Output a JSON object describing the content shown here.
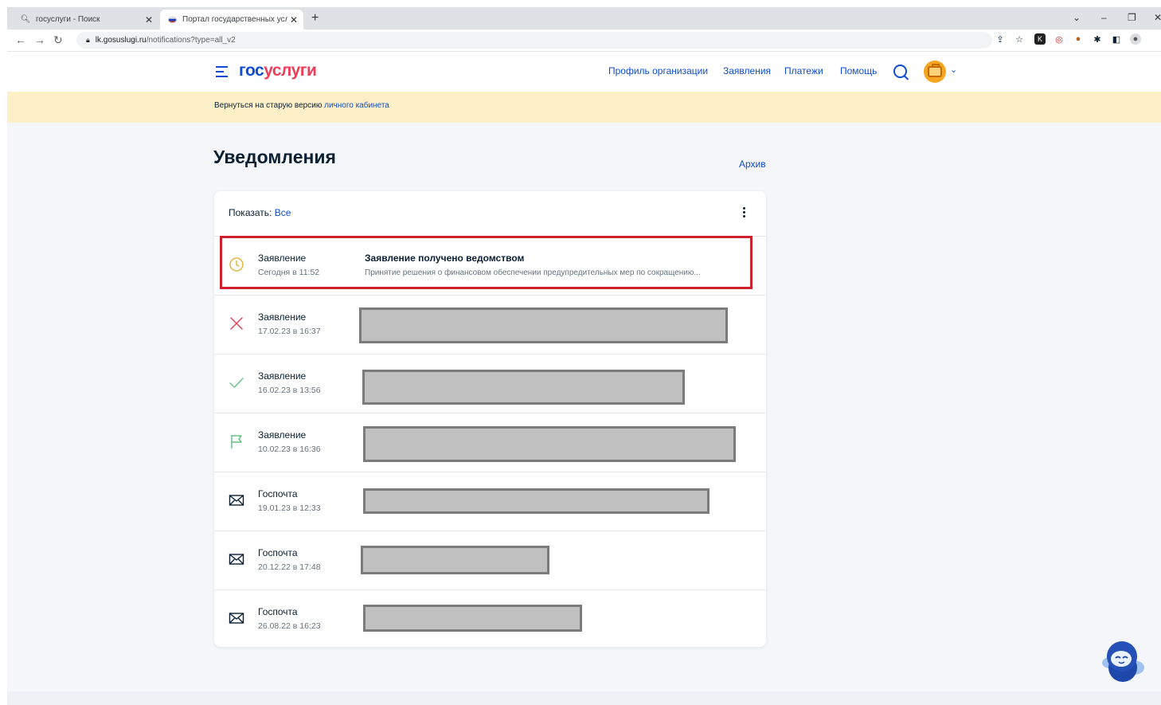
{
  "browser": {
    "tabs": [
      {
        "title": "госуслуги - Поиск",
        "icon": "search-icon"
      },
      {
        "title": "Портал государственных услуг",
        "icon": "russia-flag-icon"
      }
    ],
    "url_host": "lk.gosuslugi.ru",
    "url_path": "/notifications?type=all_v2"
  },
  "header": {
    "logo_part1": "гос",
    "logo_part2": "услуги",
    "nav": [
      "Профиль организации",
      "Заявления",
      "Платежи",
      "Помощь"
    ],
    "accent_color": "#0d4cd3",
    "logo_red": "#ee3f58"
  },
  "banner": {
    "text": "Вернуться на старую версию ",
    "link": "личного кабинета"
  },
  "page": {
    "title": "Уведомления",
    "archive_link": "Архив",
    "filter_label": "Показать: ",
    "filter_value": "Все"
  },
  "notifications": [
    {
      "type": "Заявление",
      "date": "Сегодня в 11:52",
      "title": "Заявление получено ведомством",
      "description": "Принятие решения о финансовом обеспечении предупредительных мер по сокращению...",
      "icon": "clock-icon",
      "status_color": "#e0b540"
    },
    {
      "type": "Заявление",
      "date": "17.02.23 в 16:37",
      "icon": "cross-icon",
      "status_color": "#e0455b"
    },
    {
      "type": "Заявление",
      "date": "16.02.23 в 13:56",
      "icon": "check-icon",
      "status_color": "#6cc18c"
    },
    {
      "type": "Заявление",
      "date": "10.02.23 в 16:36",
      "icon": "flag-icon",
      "status_color": "#6cc18c"
    },
    {
      "type": "Госпочта",
      "date": "19.01.23 в 12:33",
      "icon": "mail-icon"
    },
    {
      "type": "Госпочта",
      "date": "20.12.22 в 17:48",
      "icon": "mail-icon"
    },
    {
      "type": "Госпочта",
      "date": "26.08.22 в 16:23",
      "icon": "mail-icon"
    }
  ]
}
